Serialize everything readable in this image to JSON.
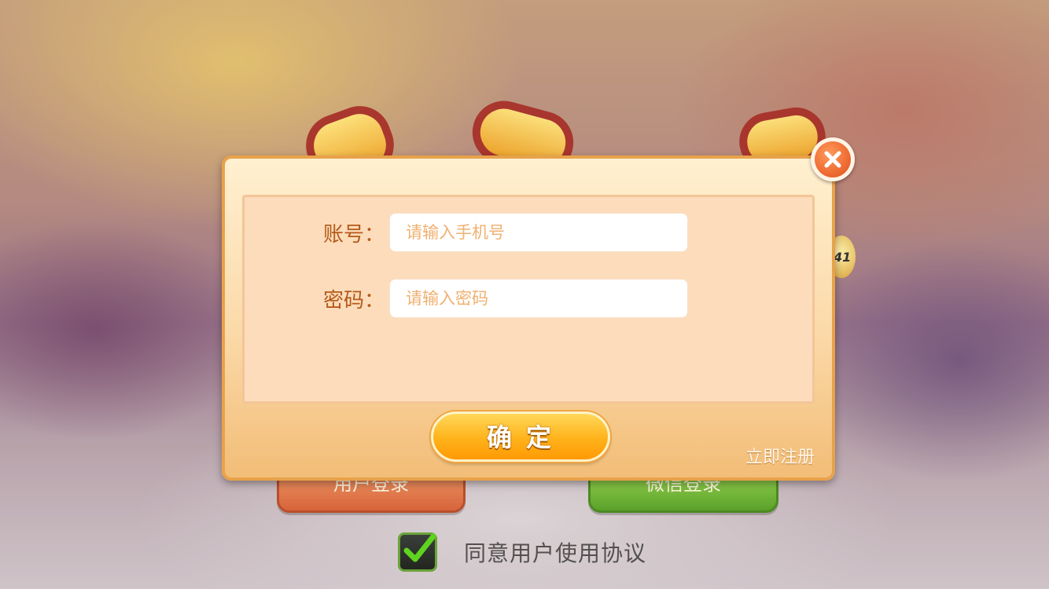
{
  "background": {
    "ball_number": "41",
    "buttons": {
      "user_login": "用户登录",
      "wechat_login": "微信登录"
    },
    "agreement": {
      "checked": true,
      "label": "同意用户使用协议"
    }
  },
  "dialog": {
    "account": {
      "label": "账号：",
      "placeholder": "请输入手机号",
      "value": ""
    },
    "password": {
      "label": "密码：",
      "placeholder": "请输入密码",
      "value": ""
    },
    "confirm_label": "确定",
    "register_label": "立即注册",
    "close_icon": "close-icon"
  },
  "colors": {
    "dialog_border": "#e8a24a",
    "label_text": "#b55a1a",
    "confirm_button": "#ffb21a",
    "close_button": "#e24e1c"
  }
}
